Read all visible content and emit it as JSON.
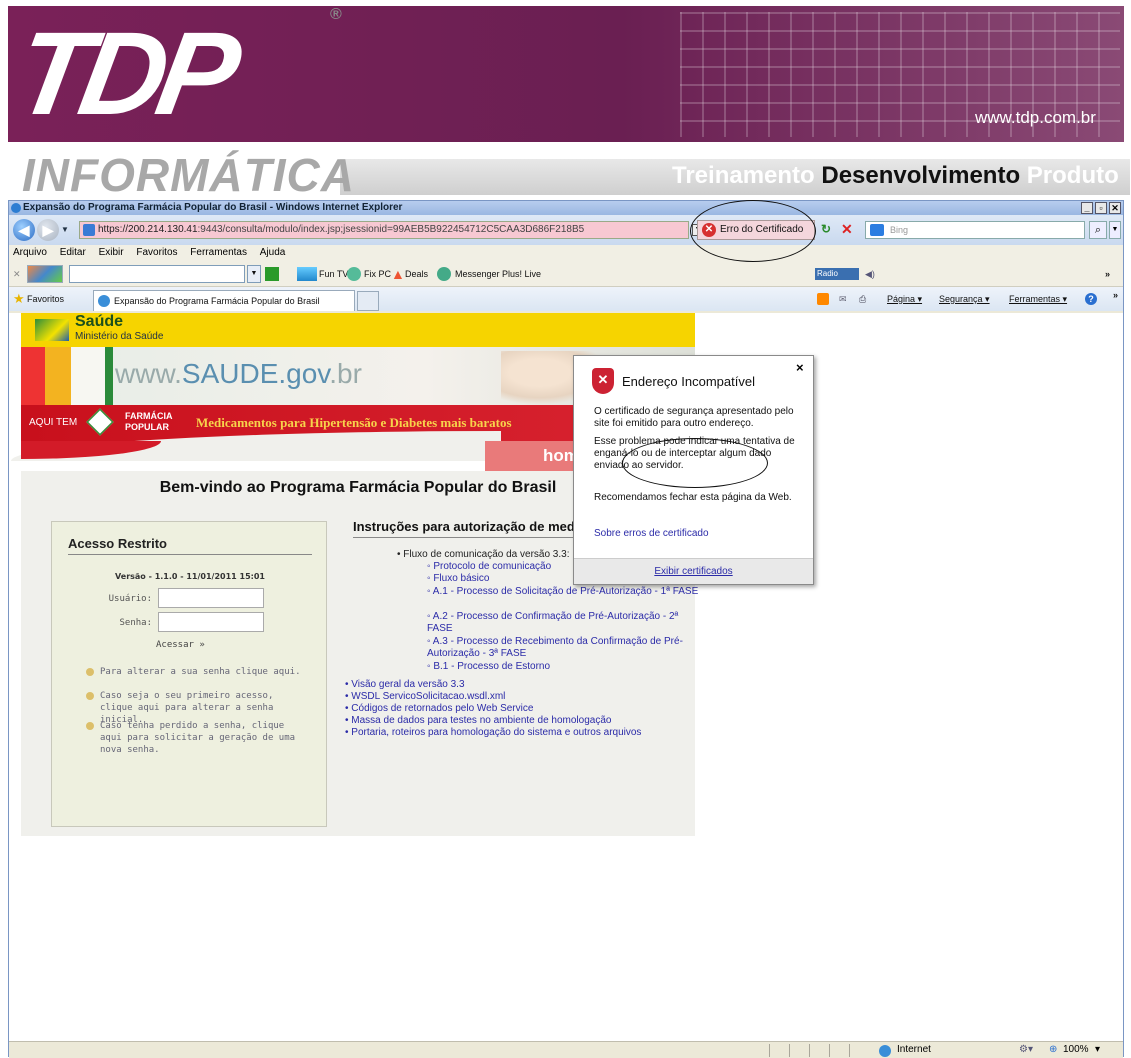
{
  "banner": {
    "logo_text": "TDP",
    "registered": "®",
    "url": "www.tdp.com.br",
    "division": "INFORMÁTICA",
    "tagline_1": "Treinamento",
    "tagline_2": "Desenvolvimento",
    "tagline_3": "Produto"
  },
  "window": {
    "title": "Expansão do Programa Farmácia Popular do Brasil - Windows Internet Explorer",
    "minimize": "_",
    "maximize": "▫",
    "close": "✕"
  },
  "address": {
    "host": "https://200.214.130.41",
    "path": ":9443/consulta/modulo/index.jsp;jsessionid=99AEB5B922454712C5CAA3D686F218B5",
    "cert_error": "Erro do Certificado",
    "search_placeholder": "Bing"
  },
  "menu": [
    "Arquivo",
    "Editar",
    "Exibir",
    "Favoritos",
    "Ferramentas",
    "Ajuda"
  ],
  "toolbar": {
    "fun_tv": "Fun TV",
    "fix_pc": "Fix PC",
    "deals": "Deals",
    "messenger": "Messenger Plus! Live",
    "radio": "Radio"
  },
  "tabs": {
    "favorites": "Favoritos",
    "current_tab": "Expansão do Programa Farmácia Popular do Brasil",
    "pagina": "Página ▾",
    "seguranca": "Segurança ▾",
    "ferramentas": "Ferramentas ▾"
  },
  "site": {
    "saude_title": "Saúde",
    "saude_sub": "Ministério da Saúde",
    "saude_url_1": "www.",
    "saude_url_2": "SAUDE.gov",
    "saude_url_3": ".br",
    "aqui_tem": "AQUI TEM",
    "farmacia": "FARMÁCIA",
    "popular": "POPULAR",
    "red_message": "Medicamentos para Hipertensão e Diabetes mais baratos",
    "homol_tab": "homo",
    "welcome": "Bem-vindo ao Programa Farmácia Popular do Brasil"
  },
  "login": {
    "title": "Acesso Restrito",
    "version": "Versão - 1.1.0 - 11/01/2011 15:01",
    "user_label": "Usuário:",
    "pass_label": "Senha:",
    "submit": "Acessar »",
    "bullets": [
      "Para alterar a sua senha clique aqui.",
      "Caso seja o seu primeiro acesso, clique aqui para alterar a senha inicial.",
      "Caso tenha perdido a senha, clique aqui para solicitar a geração de uma nova senha."
    ]
  },
  "instructions": {
    "title": "Instruções para autorização de medicamentos",
    "top_item": "Fluxo de comunicação da versão 3.3:",
    "sub_items": [
      "Protocolo de comunicação",
      "Fluxo básico",
      "A.1 - Processo de Solicitação de Pré-Autorização - 1ª FASE",
      "A.2 - Processo de Confirmação de Pré-Autorização - 2ª FASE",
      "A.3 - Processo de Recebimento da Confirmação de Pré-Autorização - 3ª FASE",
      "B.1 - Processo de Estorno"
    ],
    "items": [
      "Visão geral da versão 3.3",
      "WSDL ServicoSolicitacao.wsdl.xml",
      "Códigos de retornados pelo Web Service",
      "Massa de dados para testes no ambiente de homologação",
      "Portaria, roteiros para homologação do sistema e outros arquivos"
    ]
  },
  "popup": {
    "title": "Endereço Incompatível",
    "close": "×",
    "p1": "O certificado de segurança apresentado pelo site foi emitido para outro endereço.",
    "p2": "Esse problema pode indicar uma tentativa de enganá-lo ou de interceptar algum dado enviado ao servidor.",
    "p3": "Recomendamos fechar esta página da Web.",
    "link": "Sobre erros de certificado",
    "footer": "Exibir certificados"
  },
  "status": {
    "zone": "Internet",
    "zoom": "100%"
  }
}
